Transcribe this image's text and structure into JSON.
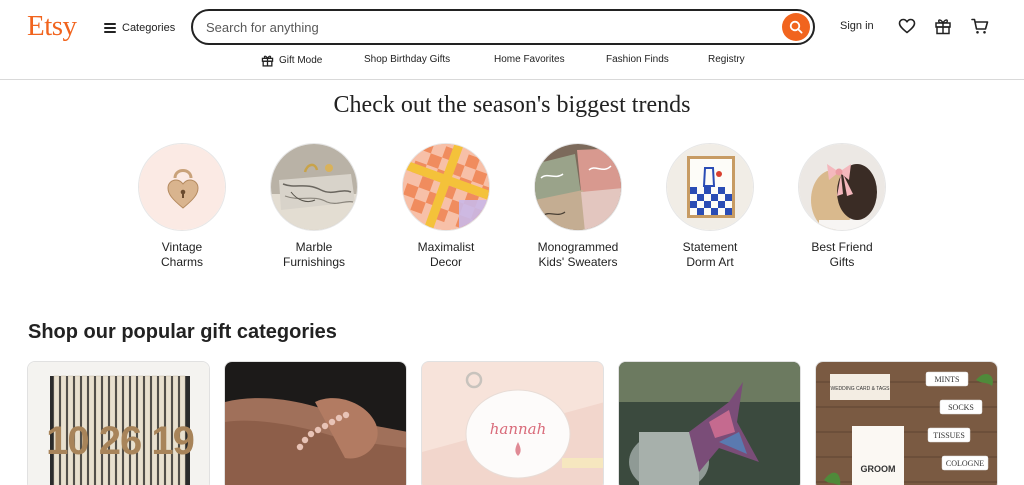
{
  "header": {
    "logo": "Etsy",
    "categories_label": "Categories",
    "search_placeholder": "Search for anything",
    "signin_label": "Sign in",
    "icons": [
      "search-icon",
      "heart-icon",
      "gift-icon",
      "cart-icon"
    ]
  },
  "subnav": [
    {
      "label": "Gift Mode",
      "icon": "gift-icon"
    },
    {
      "label": "Shop Birthday Gifts"
    },
    {
      "label": "Home Favorites"
    },
    {
      "label": "Fashion Finds"
    },
    {
      "label": "Registry"
    }
  ],
  "trends": {
    "title": "Check out the season's biggest trends",
    "items": [
      {
        "label": "Vintage\nCharms"
      },
      {
        "label": "Marble\nFurnishings"
      },
      {
        "label": "Maximalist\nDecor"
      },
      {
        "label": "Monogrammed\nKids' Sweaters"
      },
      {
        "label": "Statement\nDorm Art"
      },
      {
        "label": "Best Friend\nGifts"
      }
    ]
  },
  "gifts": {
    "title": "Shop our popular gift categories",
    "cards": [
      {
        "image_text": "10 26 19"
      },
      {
        "image_text": ""
      },
      {
        "image_text": "hannah"
      },
      {
        "image_text": ""
      },
      {
        "image_text": "GROOM",
        "tags": [
          "MINTS",
          "SOCKS",
          "TISSUES",
          "COLOGNE"
        ],
        "card_text": "WEDDING CARD & TAGS"
      }
    ]
  },
  "colors": {
    "brand": "#F1641E",
    "text": "#222222"
  }
}
